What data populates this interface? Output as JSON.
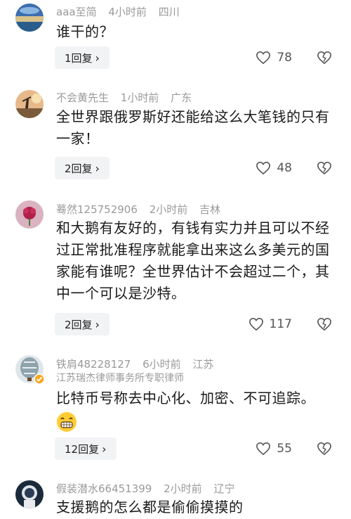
{
  "comments": [
    {
      "username": "aaa至简",
      "time": "4小时前",
      "location": "四川",
      "text": "谁干的？",
      "replies": "1回复",
      "likes": "78"
    },
    {
      "username": "不会黄先生",
      "time": "1小时前",
      "location": "广东",
      "text": "全世界跟俄罗斯好还能给这么大笔钱的只有一家！",
      "replies": "2回复",
      "likes": "48"
    },
    {
      "username": "蓦然125752906",
      "time": "2小时前",
      "location": "吉林",
      "text": "和大鹅有友好的，有钱有实力并且可以不经过正常批准程序就能拿出来这么多美元的国家能有谁呢？全世界估计不会超过二个，其中一个可以是沙特。",
      "replies": "2回复",
      "likes": "117"
    },
    {
      "username": "铁肩48228127",
      "time": "6小时前",
      "location": "江苏",
      "verified": "江苏瑞杰律师事务所专职律师",
      "text": "比特币号称去中心化、加密、不可追踪。",
      "replies": "12回复",
      "likes": "55"
    },
    {
      "username": "假装潜水66451399",
      "time": "2小时前",
      "location": "辽宁",
      "text": "支援鹅的怎么都是偷偷摸摸的"
    }
  ],
  "icons": {
    "like": "heart-outline-icon",
    "dislike": "broken-heart-icon",
    "chevron": "chevron-right-icon"
  }
}
